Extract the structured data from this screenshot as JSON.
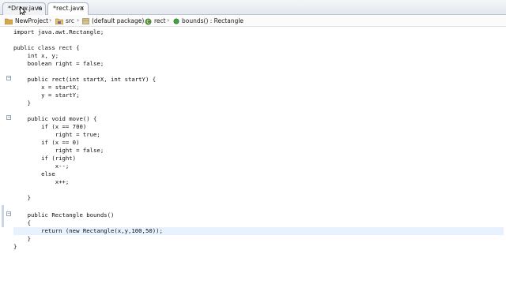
{
  "tabs": [
    {
      "label": "*Draw.java",
      "close": "✕"
    },
    {
      "label": "*rect.java",
      "close": "✕"
    }
  ],
  "breadcrumb": {
    "project": "NewProject",
    "folder": "src",
    "package": "(default package)",
    "class": "rect",
    "member": "bounds() : Rectangle"
  },
  "code": {
    "lines": [
      "import java.awt.Rectangle;",
      "",
      "public class rect {",
      "    int x, y;",
      "    boolean right = false;",
      "",
      "    public rect(int startX, int startY) {",
      "        x = startX;",
      "        y = startY;",
      "    }",
      "",
      "    public void move() {",
      "        if (x == 700)",
      "            right = true;",
      "        if (x == 0)",
      "            right = false;",
      "        if (right)",
      "            x--;",
      "        else",
      "            x++;",
      "",
      "    }",
      "",
      "    public Rectangle bounds()",
      "    {",
      "        return (new Rectangle(x,y,100,50));",
      "    }",
      "}"
    ]
  },
  "colors": {
    "current_line": "#e8f2fe",
    "tab_border": "#a9b6c8"
  }
}
